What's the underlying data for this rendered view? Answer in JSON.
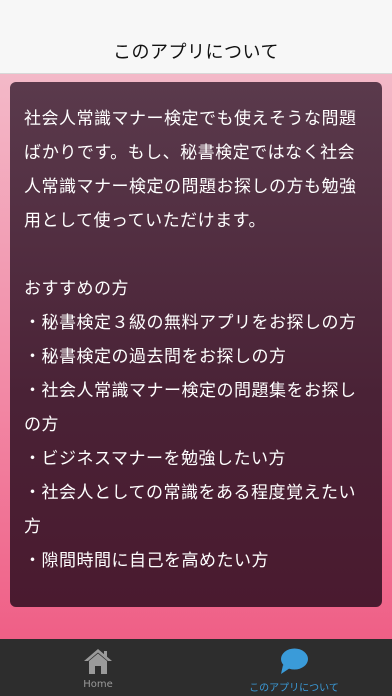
{
  "nav": {
    "title": "このアプリについて"
  },
  "content": {
    "intro": "社会人常識マナー検定でも使えそうな問題ばかりです。もし、秘書検定ではなく社会人常識マナー検定の問題お探しの方も勉強用として使っていただけます。",
    "recommend_heading": "おすすめの方",
    "recommend_items": [
      "・秘書検定３級の無料アプリをお探しの方",
      "・秘書検定の過去問をお探しの方",
      "・社会人常識マナー検定の問題集をお探しの方",
      "・ビジネスマナーを勉強したい方",
      "・社会人としての常識をある程度覚えたい方",
      "・隙間時間に自己を高めたい方"
    ]
  },
  "tabs": {
    "home": {
      "label": "Home",
      "icon": "home-icon"
    },
    "about": {
      "label": "このアプリについて",
      "icon": "speech-bubble-icon"
    }
  },
  "colors": {
    "active_tab": "#3a9bd9",
    "inactive_tab": "#9a9a9a",
    "panel": "#4a2236",
    "background_pink": "#f28aa6"
  }
}
